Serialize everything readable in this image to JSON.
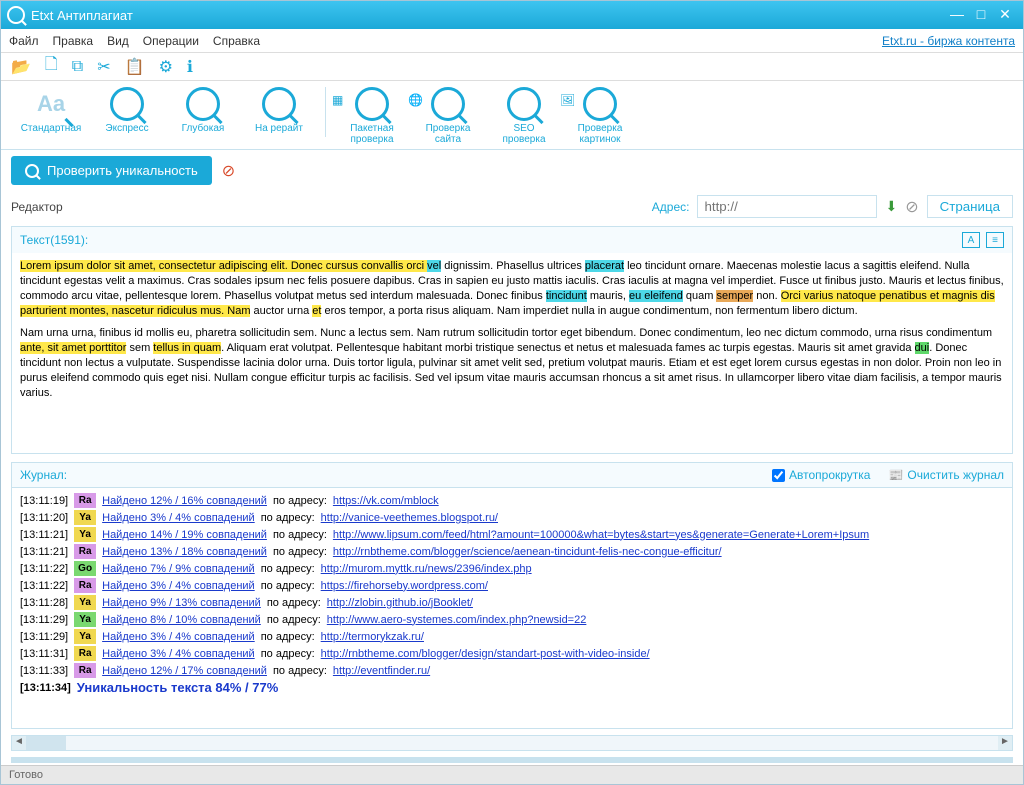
{
  "titlebar": {
    "title": "Etxt Антиплагиат"
  },
  "menu": {
    "file": "Файл",
    "edit": "Правка",
    "view": "Вид",
    "ops": "Операции",
    "help": "Справка",
    "right_link": "Etxt.ru - биржа контента"
  },
  "ribbon": {
    "g1": [
      {
        "label": "Стандартная"
      },
      {
        "label": "Экспресс"
      },
      {
        "label": "Глубокая"
      },
      {
        "label": "На рерайт"
      }
    ],
    "g2": [
      {
        "label": "Пакетная проверка"
      },
      {
        "label": "Проверка сайта"
      },
      {
        "label": "SEO проверка"
      },
      {
        "label": "Проверка картинок"
      }
    ]
  },
  "action": {
    "check": "Проверить уникальность"
  },
  "addr": {
    "editor": "Редактор",
    "label": "Адрес:",
    "placeholder": "http://",
    "page": "Страница"
  },
  "editor": {
    "head": "Текст(1591):",
    "para1_pre": "Lorem ipsum dolor sit amet, consectetur adipiscing elit. Donec cursus convallis orci ",
    "w_vel": "vel",
    "p1_a": " dignissim. Phasellus ultrices ",
    "w_placerat": "placerat",
    "p1_b": " leo tincidunt ornare. Maecenas molestie lacus a sagittis eleifend. Nulla tincidunt egestas velit a maximus. Cras sodales ipsum nec felis posuere dapibus. Cras in sapien eu justo mattis iaculis. Cras iaculis at magna vel imperdiet. Fusce ut finibus justo. Mauris et lectus finibus, commodo arcu vitae, pellentesque lorem. Phasellus volutpat metus sed interdum malesuada. Donec finibus ",
    "w_tinc": "tincidunt",
    "p1_c": " mauris, ",
    "w_eu": "eu eleifend",
    "p1_d": " quam ",
    "w_semper": "semper",
    "p1_e": " non. ",
    "p1_f": "Orci varius natoque penatibus et magnis dis parturient montes, nascetur ridiculus mus. Nam",
    "p1_g": " auctor urna ",
    "w_et": "et",
    "p1_h": " eros tempor, a porta risus aliquam. Nam imperdiet nulla in augue condimentum, non fermentum libero dictum.",
    "para2_a": "Nam urna urna, finibus id mollis eu, pharetra sollicitudin sem. Nunc a lectus sem. Nam rutrum sollicitudin tortor eget bibendum. Donec condimentum, leo nec dictum commodo, urna risus condimentum ",
    "w_ante": "ante, sit amet porttitor",
    "p2_b": " sem ",
    "w_tellus": "tellus in quam",
    "p2_c": ". Aliquam erat volutpat. Pellentesque habitant morbi tristique senectus et netus et malesuada fames ac turpis egestas. Mauris sit amet gravida ",
    "w_dui": "dui",
    "p2_d": ". Donec tincidunt non lectus a vulputate. Suspendisse lacinia dolor urna. Duis tortor ligula, pulvinar sit amet velit sed, pretium volutpat mauris. Etiam et est eget lorem cursus egestas in non dolor. Proin non leo in purus eleifend commodo quis eget nisi. Nullam congue efficitur turpis ac facilisis. Sed vel ipsum vitae mauris accumsan rhoncus a sit amet risus. In ullamcorper libero vitae diam facilisis, a tempor mauris varius."
  },
  "journal": {
    "head": "Журнал:",
    "autoscroll": "Автопрокрутка",
    "clear": "Очистить журнал",
    "addr_label": " по адресу: ",
    "rows": [
      {
        "time": "[13:11:19]",
        "badge": "Ra",
        "bc": "b-Ra",
        "found": "Найдено 12% / 16% совпадений",
        "url": "https://vk.com/mblock"
      },
      {
        "time": "[13:11:20]",
        "badge": "Ya",
        "bc": "b-Ya",
        "found": "Найдено 3% / 4% совпадений",
        "url": "http://vanice-veethemes.blogspot.ru/"
      },
      {
        "time": "[13:11:21]",
        "badge": "Ya",
        "bc": "b-Ya",
        "found": "Найдено 14% / 19% совпадений",
        "url": "http://www.lipsum.com/feed/html?amount=100000&what=bytes&start=yes&generate=Generate+Lorem+Ipsum"
      },
      {
        "time": "[13:11:21]",
        "badge": "Ra",
        "bc": "b-Ra",
        "found": "Найдено 13% / 18% совпадений",
        "url": "http://rnbtheme.com/blogger/science/aenean-tincidunt-felis-nec-congue-efficitur/"
      },
      {
        "time": "[13:11:22]",
        "badge": "Go",
        "bc": "b-Go",
        "found": "Найдено 7% / 9% совпадений",
        "url": "http://murom.myttk.ru/news/2396/index.php"
      },
      {
        "time": "[13:11:22]",
        "badge": "Ra",
        "bc": "b-Ra",
        "found": "Найдено 3% / 4% совпадений",
        "url": "https://firehorseby.wordpress.com/"
      },
      {
        "time": "[13:11:28]",
        "badge": "Ya",
        "bc": "b-Ya",
        "found": "Найдено 9% / 13% совпадений",
        "url": "http://zlobin.github.io/jBooklet/"
      },
      {
        "time": "[13:11:29]",
        "badge": "Ya",
        "bc": "b-Go",
        "found": "Найдено 8% / 10% совпадений",
        "url": "http://www.aero-systemes.com/index.php?newsid=22"
      },
      {
        "time": "[13:11:29]",
        "badge": "Ya",
        "bc": "b-Ya",
        "found": "Найдено 3% / 4% совпадений",
        "url": "http://termorykzak.ru/"
      },
      {
        "time": "[13:11:31]",
        "badge": "Ra",
        "bc": "b-Ya",
        "found": "Найдено 3% / 4% совпадений",
        "url": "http://rnbtheme.com/blogger/design/standart-post-with-video-inside/"
      },
      {
        "time": "[13:11:33]",
        "badge": "Ra",
        "bc": "b-Ra",
        "found": "Найдено 12% / 17% совпадений",
        "url": "http://eventfinder.ru/"
      }
    ],
    "final_time": "[13:11:34]",
    "final": "Уникальность текста 84% / 77%"
  },
  "status": {
    "text": "Готово"
  }
}
